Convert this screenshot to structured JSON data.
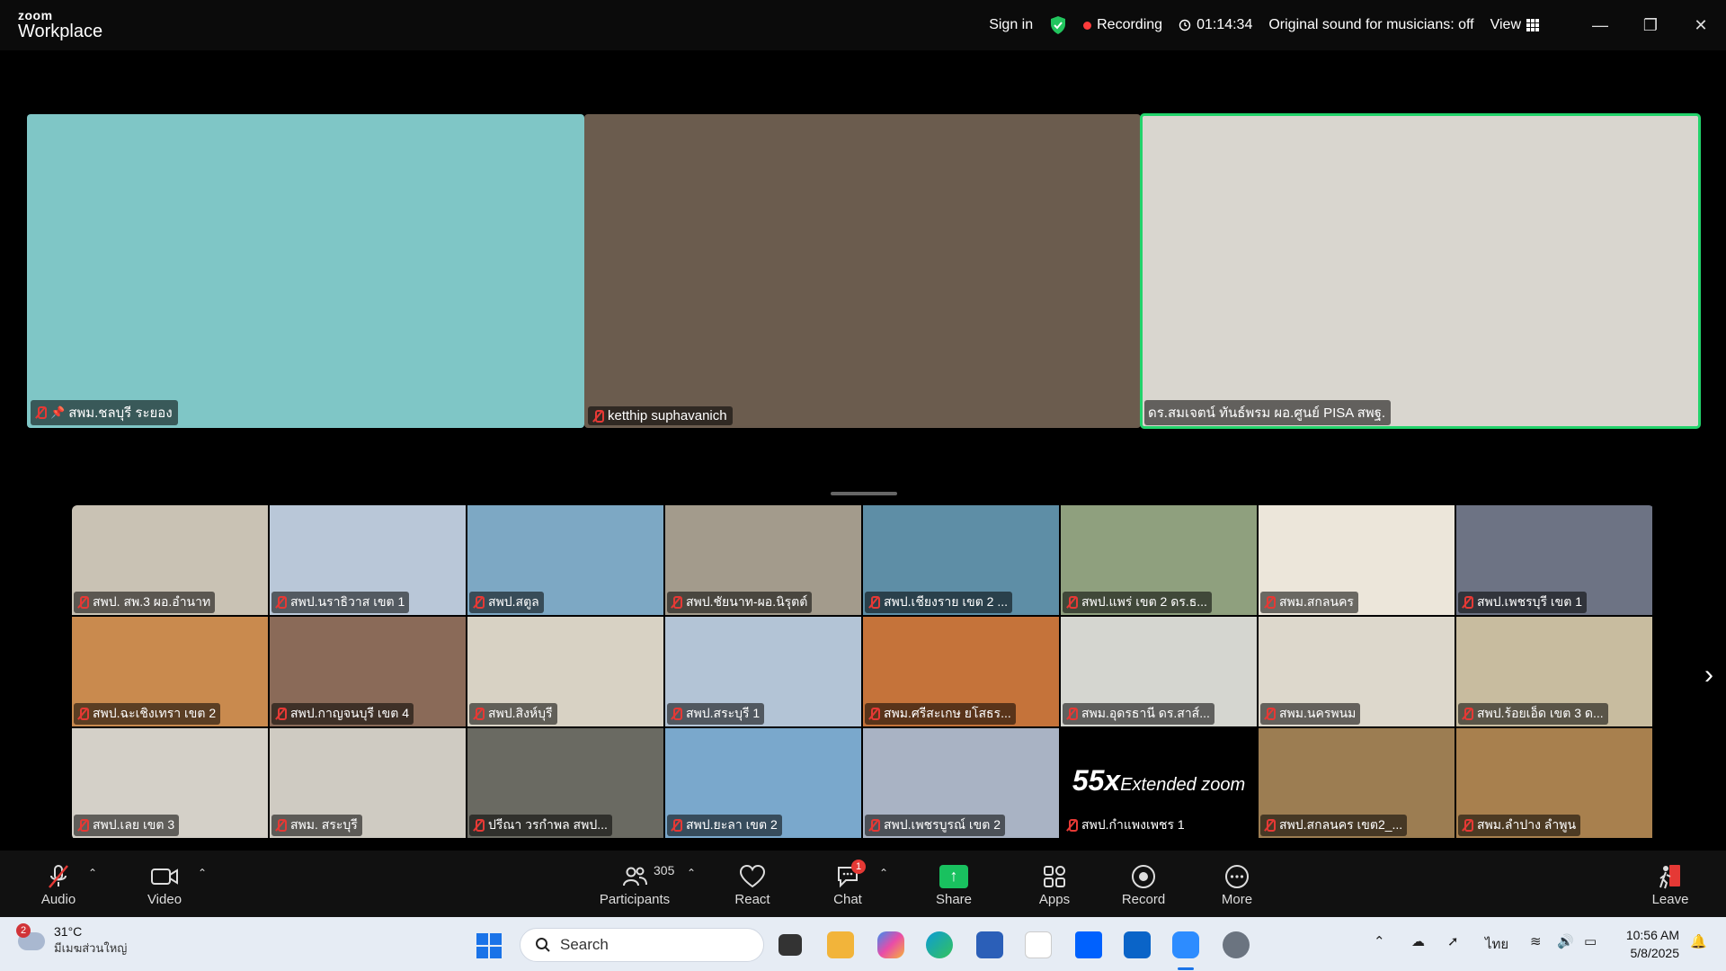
{
  "app": {
    "logo_top": "zoom",
    "logo_bottom": "Workplace"
  },
  "titlebar": {
    "sign_in": "Sign in",
    "recording": "Recording",
    "timer": "01:14:34",
    "original_sound": "Original sound for musicians: off",
    "view": "View"
  },
  "speakers": [
    {
      "name": "สพม.ชลบุรี ระยอง",
      "pinned": true,
      "bg": "#7fc6c6"
    },
    {
      "name": "ketthip suphavanich",
      "pinned": false,
      "bg": "#6b5c4e"
    },
    {
      "name": "ดร.สมเจตน์ ทันธ์พรม ผอ.ศูนย์ PISA สพฐ.",
      "pinned": false,
      "bg": "#d9d6cf"
    }
  ],
  "gallery": [
    {
      "name": "สพป. สพ.3 ผอ.อำนาท",
      "bg": "#c9c2b4"
    },
    {
      "name": "สพป.นราธิวาส เขต 1",
      "bg": "#b9c7d8"
    },
    {
      "name": "สพป.สตูล",
      "bg": "#7da8c4"
    },
    {
      "name": "สพป.ชัยนาท-ผอ.นิรุตต์",
      "bg": "#a39b8c"
    },
    {
      "name": "สพป.เชียงราย เขต 2 ...",
      "bg": "#5e8ea6"
    },
    {
      "name": "สพป.แพร่ เขต 2 ดร.ธ...",
      "bg": "#8fa07e"
    },
    {
      "name": "สพม.สกลนคร",
      "bg": "#ece6da"
    },
    {
      "name": "สพป.เพชรบุรี เขต 1",
      "bg": "#6d7384"
    },
    {
      "name": "สพป.ฉะเชิงเทรา เขต 2",
      "bg": "#c98a4e"
    },
    {
      "name": "สพป.กาญจนบุรี เขต 4",
      "bg": "#8a6a58"
    },
    {
      "name": "สพป.สิงห์บุรี",
      "bg": "#d8d2c4"
    },
    {
      "name": "สพป.สระบุรี 1",
      "bg": "#b3c4d6"
    },
    {
      "name": "สพม.ศรีสะเกษ ยโสธร...",
      "bg": "#c5733a"
    },
    {
      "name": "สพม.อุดรธานี ดร.สาส์...",
      "bg": "#d5d6d0"
    },
    {
      "name": "สพม.นครพนม",
      "bg": "#ddd8cc"
    },
    {
      "name": "สพป.ร้อยเอ็ด เขต 3 ด...",
      "bg": "#c8bc9f"
    },
    {
      "name": "สพป.เลย เขต 3",
      "bg": "#d4d0c8"
    },
    {
      "name": "สพม. สระบุรี",
      "bg": "#cfcbc2"
    },
    {
      "name": "ปรีณา วรกำพล สพป...",
      "bg": "#6a6a62"
    },
    {
      "name": "สพป.ยะลา เขต 2",
      "bg": "#7aa8cc"
    },
    {
      "name": "สพป.เพชรบูรณ์ เขต 2",
      "bg": "#a9b3c4"
    },
    {
      "name": "สพป.กำแพงเพชร 1",
      "bg": "#000000",
      "promo": {
        "big": "55x",
        "small": "Extended zoom"
      }
    },
    {
      "name": "สพป.สกลนคร เขต2_...",
      "bg": "#9c7d52"
    },
    {
      "name": "สพม.ลำปาง ลำพูน",
      "bg": "#a8804e"
    }
  ],
  "toolbar": {
    "audio": "Audio",
    "video": "Video",
    "participants": "Participants",
    "participants_count": "305",
    "react": "React",
    "chat": "Chat",
    "chat_badge": "1",
    "share": "Share",
    "apps": "Apps",
    "record": "Record",
    "more": "More",
    "leave": "Leave"
  },
  "taskbar": {
    "weather_badge": "2",
    "temperature": "31°C",
    "weather_text": "มีเมฆส่วนใหญ่",
    "search_placeholder": "Search",
    "language": "ไทย",
    "time": "10:56 AM",
    "date": "5/8/2025"
  },
  "colors": {
    "active_speaker": "#22d36b",
    "muted": "#e53935",
    "share": "#19c15f"
  }
}
